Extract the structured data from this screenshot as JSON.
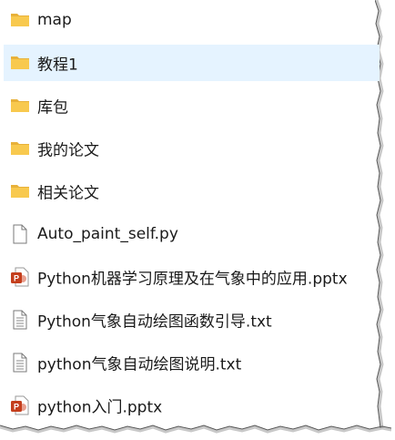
{
  "files": [
    {
      "name": "map",
      "type": "folder",
      "icon": "folder-icon"
    },
    {
      "name": "教程1",
      "type": "folder",
      "icon": "folder-icon",
      "selected": true
    },
    {
      "name": "库包",
      "type": "folder",
      "icon": "folder-icon"
    },
    {
      "name": "我的论文",
      "type": "folder",
      "icon": "folder-icon"
    },
    {
      "name": "相关论文",
      "type": "folder",
      "icon": "folder-icon"
    },
    {
      "name": "Auto_paint_self.py",
      "type": "file",
      "icon": "blank-file-icon"
    },
    {
      "name": "Python机器学习原理及在气象中的应用.pptx",
      "type": "pptx",
      "icon": "powerpoint-file-icon"
    },
    {
      "name": "Python气象自动绘图函数引导.txt",
      "type": "txt",
      "icon": "text-file-icon"
    },
    {
      "name": "python气象自动绘图说明.txt",
      "type": "txt",
      "icon": "text-file-icon"
    },
    {
      "name": "python入门.pptx",
      "type": "pptx",
      "icon": "powerpoint-file-icon"
    }
  ],
  "colors": {
    "selection": "#e5f3ff",
    "folder": "#f8c94e",
    "powerpoint": "#c43e1c"
  }
}
